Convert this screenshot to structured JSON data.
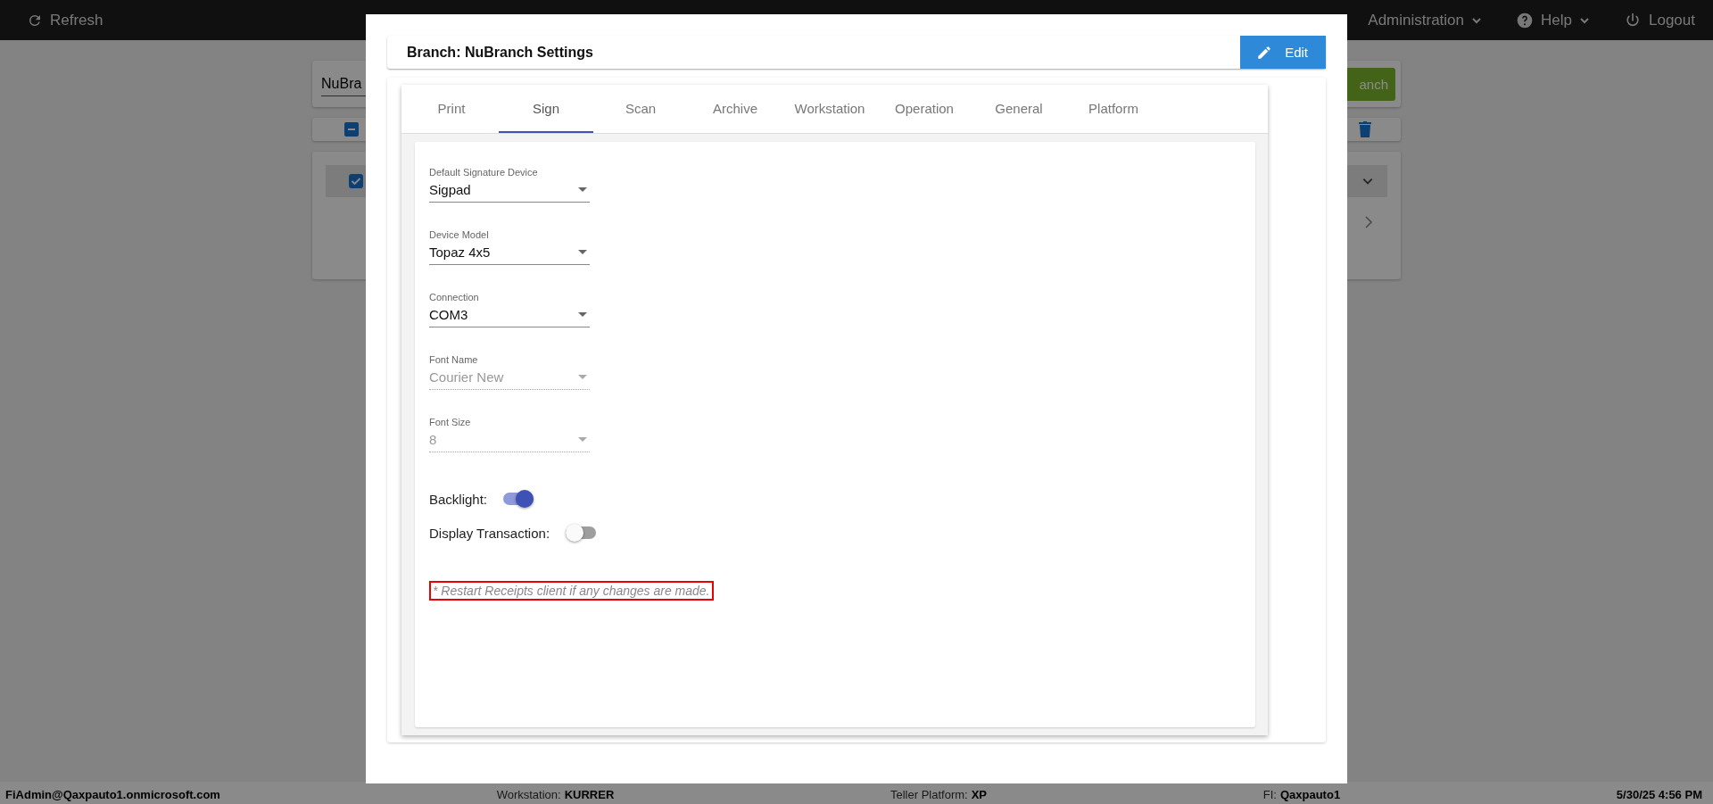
{
  "top_bar": {
    "refresh": "Refresh",
    "menus": [
      {
        "label": "Administration",
        "kind": "dropdown"
      },
      {
        "label": "Help",
        "kind": "help"
      },
      {
        "label": "Logout",
        "kind": "logout"
      }
    ]
  },
  "background": {
    "search_value": "NuBra",
    "search_button": "anch",
    "row": {
      "checked": true
    }
  },
  "modal": {
    "title": "Branch: NuBranch Settings",
    "edit_button": "Edit",
    "tabs": [
      {
        "label": "Print",
        "selected": false
      },
      {
        "label": "Sign",
        "selected": true
      },
      {
        "label": "Scan",
        "selected": false
      },
      {
        "label": "Archive",
        "selected": false
      },
      {
        "label": "Workstation",
        "selected": false
      },
      {
        "label": "Operation",
        "selected": false
      },
      {
        "label": "General",
        "selected": false
      },
      {
        "label": "Platform",
        "selected": false
      }
    ],
    "fields": [
      {
        "label": "Default Signature Device",
        "value": "Sigpad",
        "disabled": false
      },
      {
        "label": "Device Model",
        "value": "Topaz 4x5",
        "disabled": false
      },
      {
        "label": "Connection",
        "value": "COM3",
        "disabled": false
      },
      {
        "label": "Font Name",
        "value": "Courier New",
        "disabled": true
      },
      {
        "label": "Font Size",
        "value": "8",
        "disabled": true
      }
    ],
    "toggles": [
      {
        "label": "Backlight:",
        "on": true
      },
      {
        "label": "Display Transaction:",
        "on": false
      }
    ],
    "note": "* Restart Receipts client if any changes are made."
  },
  "status_bar": {
    "user": "FiAdmin@Qaxpauto1.onmicrosoft.com",
    "workstation": {
      "label": "Workstation:",
      "value": "KURRER"
    },
    "platform": {
      "label": "Teller Platform:",
      "value": "XP"
    },
    "fi": {
      "label": "FI:",
      "value": "Qaxpauto1"
    },
    "datetime": "5/30/25 4:56 PM"
  }
}
